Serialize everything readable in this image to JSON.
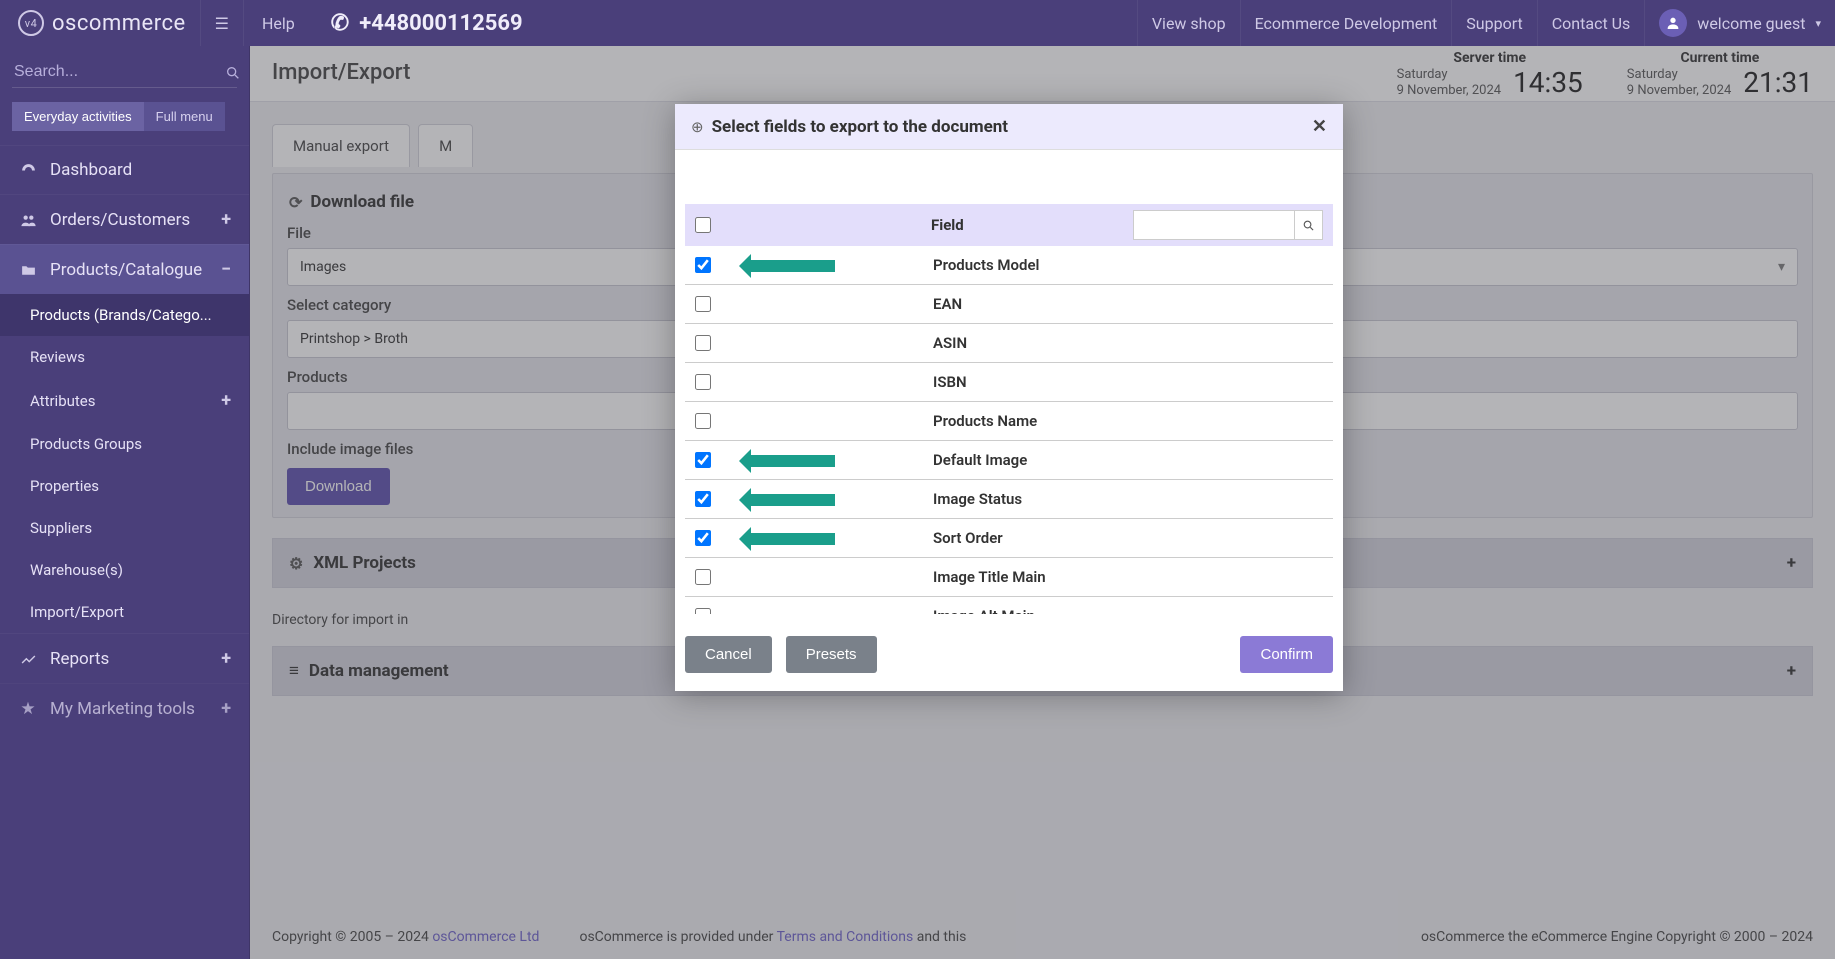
{
  "brand": "oscommerce",
  "brand_badge": "v4",
  "topbar": {
    "help": "Help",
    "phone": "+448000112569",
    "links": {
      "view_shop": "View shop",
      "dev": "Ecommerce Development",
      "support": "Support",
      "contact": "Contact Us"
    },
    "user_greeting": "welcome guest"
  },
  "search_placeholder": "Search...",
  "menu_toggle": {
    "everyday": "Everyday activities",
    "full": "Full menu"
  },
  "nav": {
    "dashboard": "Dashboard",
    "orders": "Orders/Customers",
    "catalogue": "Products/Catalogue",
    "sub": {
      "products": "Products (Brands/Catego...",
      "reviews": "Reviews",
      "attributes": "Attributes",
      "groups": "Products Groups",
      "properties": "Properties",
      "suppliers": "Suppliers",
      "warehouses": "Warehouse(s)",
      "importexport": "Import/Export"
    },
    "reports": "Reports",
    "marketing": "My Marketing tools"
  },
  "page_title": "Import/Export",
  "times": {
    "server_label": "Server time",
    "server_date_1": "Saturday",
    "server_date_2": "9 November, 2024",
    "server_time": "14:35",
    "current_label": "Current time",
    "current_date_1": "Saturday",
    "current_date_2": "9 November, 2024",
    "current_time": "21:31"
  },
  "tabs": {
    "manual": "Manual export",
    "other": "M"
  },
  "download_panel": {
    "title": "Download file",
    "file_label": "File",
    "file_value": "Images",
    "category_label": "Select category",
    "category_value": "Printshop  >  Broth",
    "products_label": "Products",
    "include_label": "Include image files",
    "download_btn": "Download"
  },
  "xml_panel_title": "XML Projects",
  "dir_text": "Directory for import in",
  "data_mgmt_title": "Data management",
  "footer": {
    "c1a": "Copyright © 2005 – 2024 ",
    "c1b": "osCommerce Ltd",
    "c2a": "osCommerce is provided under ",
    "c2b": "Terms and Conditions",
    "c2c": " and this",
    "c3": "osCommerce the eCommerce Engine Copyright © 2000 – 2024"
  },
  "modal": {
    "title": "Select fields to export to the document",
    "header_label": "Field",
    "rows": [
      {
        "label": "Products Model",
        "checked": true,
        "arrow": true
      },
      {
        "label": "EAN",
        "checked": false,
        "arrow": false
      },
      {
        "label": "ASIN",
        "checked": false,
        "arrow": false
      },
      {
        "label": "ISBN",
        "checked": false,
        "arrow": false
      },
      {
        "label": "Products Name",
        "checked": false,
        "arrow": false
      },
      {
        "label": "Default Image",
        "checked": true,
        "arrow": true
      },
      {
        "label": "Image Status",
        "checked": true,
        "arrow": true
      },
      {
        "label": "Sort Order",
        "checked": true,
        "arrow": true
      },
      {
        "label": "Image Title Main",
        "checked": false,
        "arrow": false
      },
      {
        "label": "Image Alt Main",
        "checked": false,
        "arrow": false
      }
    ],
    "cancel": "Cancel",
    "presets": "Presets",
    "confirm": "Confirm"
  }
}
